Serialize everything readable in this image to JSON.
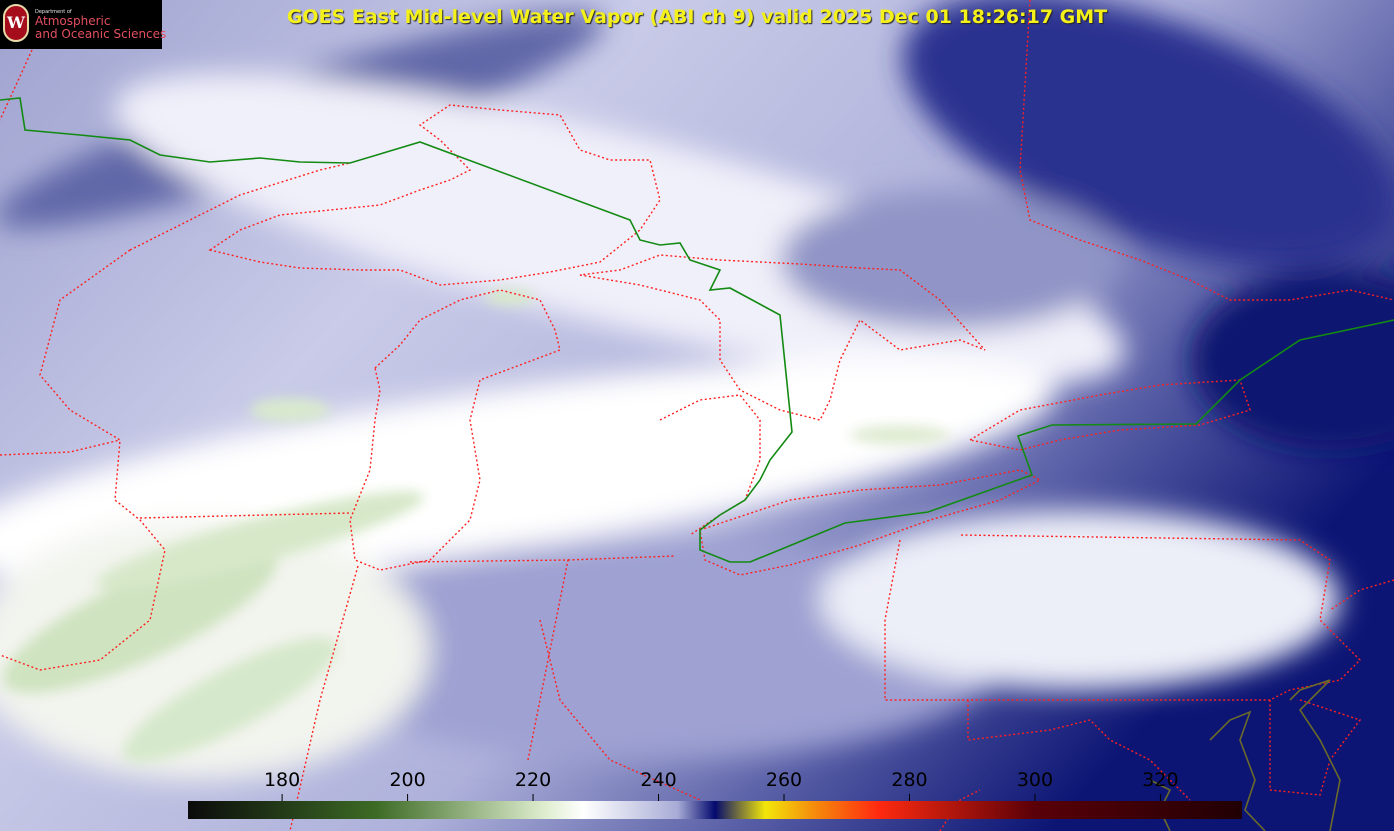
{
  "title": "GOES East Mid-level Water Vapor (ABI ch 9)  valid 2025 Dec 01 18:26:17 GMT",
  "logo": {
    "dept": "Department of",
    "line1": "Atmospheric",
    "line2": "and Oceanic Sciences",
    "seal_letter": "W"
  },
  "colorbar": {
    "ticks": [
      "180",
      "200",
      "220",
      "240",
      "260",
      "280",
      "300",
      "320"
    ],
    "tick_values": [
      180,
      200,
      220,
      240,
      260,
      280,
      300,
      320
    ],
    "range": [
      165,
      333
    ],
    "colors": {
      "dark": "#0a0a0a",
      "green": "#3d6b25",
      "light_green": "#dfeecf",
      "white": "#ffffff",
      "lavender": "#a8acd6",
      "navy": "#040a6e",
      "yellow": "#f2e60a",
      "orange": "#f58a0c",
      "red": "#ff2a10",
      "dark_red": "#5a0008"
    }
  },
  "map": {
    "background_colors": [
      "#0a1270",
      "#7d82b8",
      "#dfe0f2",
      "#e6f0dc"
    ],
    "state_boundary_color": "#ff2020",
    "border_color": "#0a8a0a",
    "coast_color": "#6b6a2a"
  }
}
